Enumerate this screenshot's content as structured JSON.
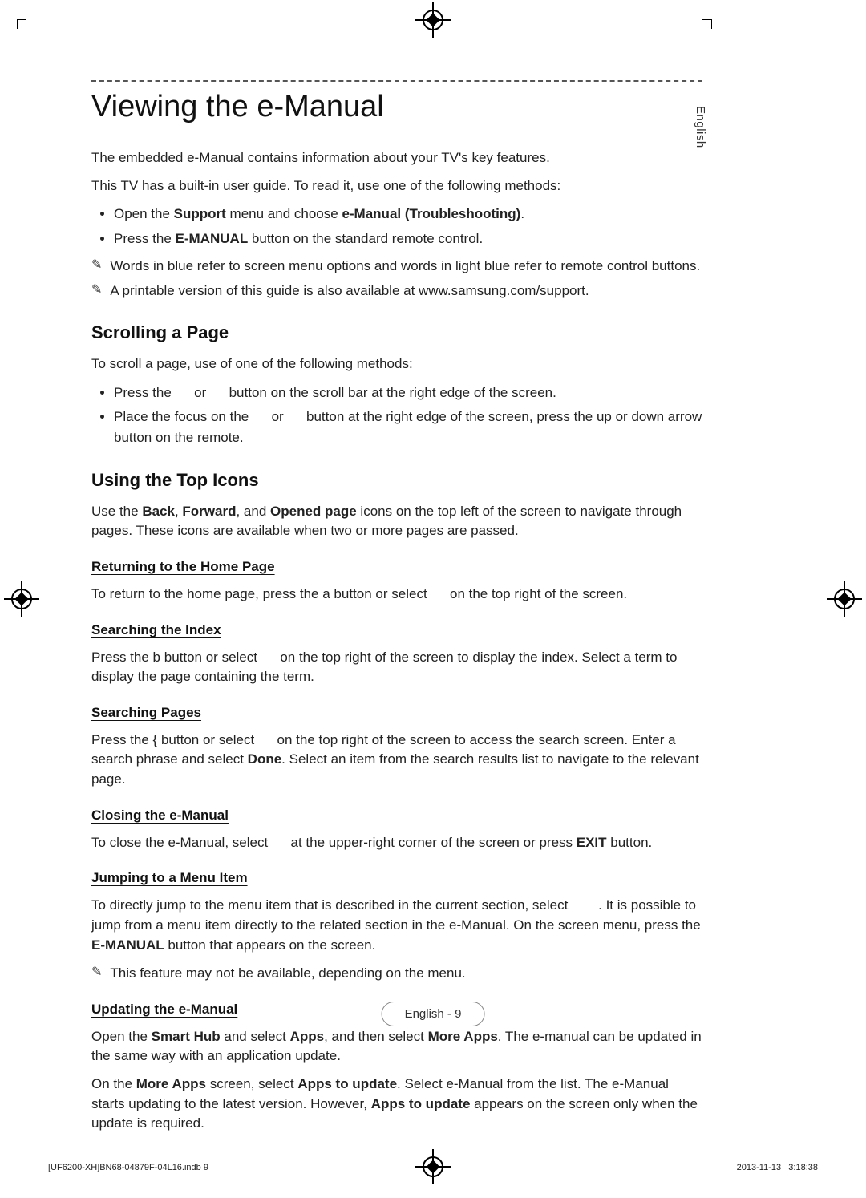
{
  "language_tab": "English",
  "title": "Viewing the e-Manual",
  "intro": {
    "p1": "The embedded e-Manual contains information about your TV's key features.",
    "p2": "This TV has a built-in user guide. To read it, use one of the following methods:"
  },
  "intro_bullets": [
    {
      "pre": "Open the ",
      "b1": "Support",
      "mid": " menu and choose ",
      "b2": "e-Manual (Troubleshooting)",
      "post": "."
    },
    {
      "pre": "Press the ",
      "b1": "E-MANUAL",
      "mid": " button on the standard remote control.",
      "b2": "",
      "post": ""
    }
  ],
  "intro_notes": [
    "Words in blue refer to screen menu options and words in light blue refer to remote control buttons.",
    "A printable version of this guide is also available at www.samsung.com/support."
  ],
  "scrolling": {
    "heading": "Scrolling a Page",
    "intro": "To scroll a page, use of one of the following methods:",
    "b1": "Press the      or      button on the scroll bar at the right edge of the screen.",
    "b2": "Place the focus on the      or      button at the right edge of the screen, press the up or down arrow button on the remote."
  },
  "topicons": {
    "heading": "Using the Top Icons",
    "intro_parts": {
      "a": "Use the ",
      "b1": "Back",
      "c": ", ",
      "b2": "Forward",
      "d": ", and ",
      "b3": "Opened page",
      "e": " icons on the top left of the screen to navigate through pages. These icons are available when two or more pages are passed."
    }
  },
  "home": {
    "heading": "Returning to the Home Page",
    "body_parts": {
      "a": "To return to the home page, press the ",
      "b": "a",
      "c": " button or select      on the top right of the screen."
    }
  },
  "index": {
    "heading": "Searching the Index",
    "body_parts": {
      "a": "Press the ",
      "b": "b",
      "c": " button or select      on the top right of the screen to display the index. Select a term to display the page containing the term."
    }
  },
  "search": {
    "heading": "Searching Pages",
    "body_parts": {
      "a": "Press the ",
      "b": "{",
      "c": " button or select      on the top right of the screen to access the search screen. Enter a search phrase and select ",
      "d": "Done",
      "e": ". Select an item from the search results list to navigate to the relevant page."
    }
  },
  "closing": {
    "heading": "Closing the e-Manual",
    "body_parts": {
      "a": "To close the e-Manual, select      at the upper-right corner of the screen or press ",
      "b": "EXIT",
      "c": " button."
    }
  },
  "jumping": {
    "heading": "Jumping to a Menu Item",
    "p1_parts": {
      "a": "To directly jump to the menu item that is described in the current section, select        . It is possible to jump from a menu item directly to the related section in the e-Manual. On the screen menu, press the ",
      "b": "E-MANUAL",
      "c": " button that appears on the screen."
    },
    "note": "This feature may not be available, depending on the menu."
  },
  "updating": {
    "heading": "Updating the e-Manual",
    "p1_parts": {
      "a": "Open the ",
      "b1": "Smart Hub",
      "c": " and select ",
      "b2": "Apps",
      "d": ", and then select ",
      "b3": "More Apps",
      "e": ". The e-manual can be updated in the same way with an application update."
    },
    "p2_parts": {
      "a": "On the ",
      "b1": "More Apps",
      "c": " screen, select ",
      "b2": "Apps to update",
      "d": ". Select e-Manual from the list. The e-Manual starts updating to the latest version. However, ",
      "b3": "Apps to update",
      "e": " appears on the screen only when the update is required."
    }
  },
  "page_number": "English - 9",
  "footer": {
    "left": "[UF6200-XH]BN68-04879F-04L16.indb   9",
    "date": "2013-11-13",
    "time": "3:18:38"
  }
}
